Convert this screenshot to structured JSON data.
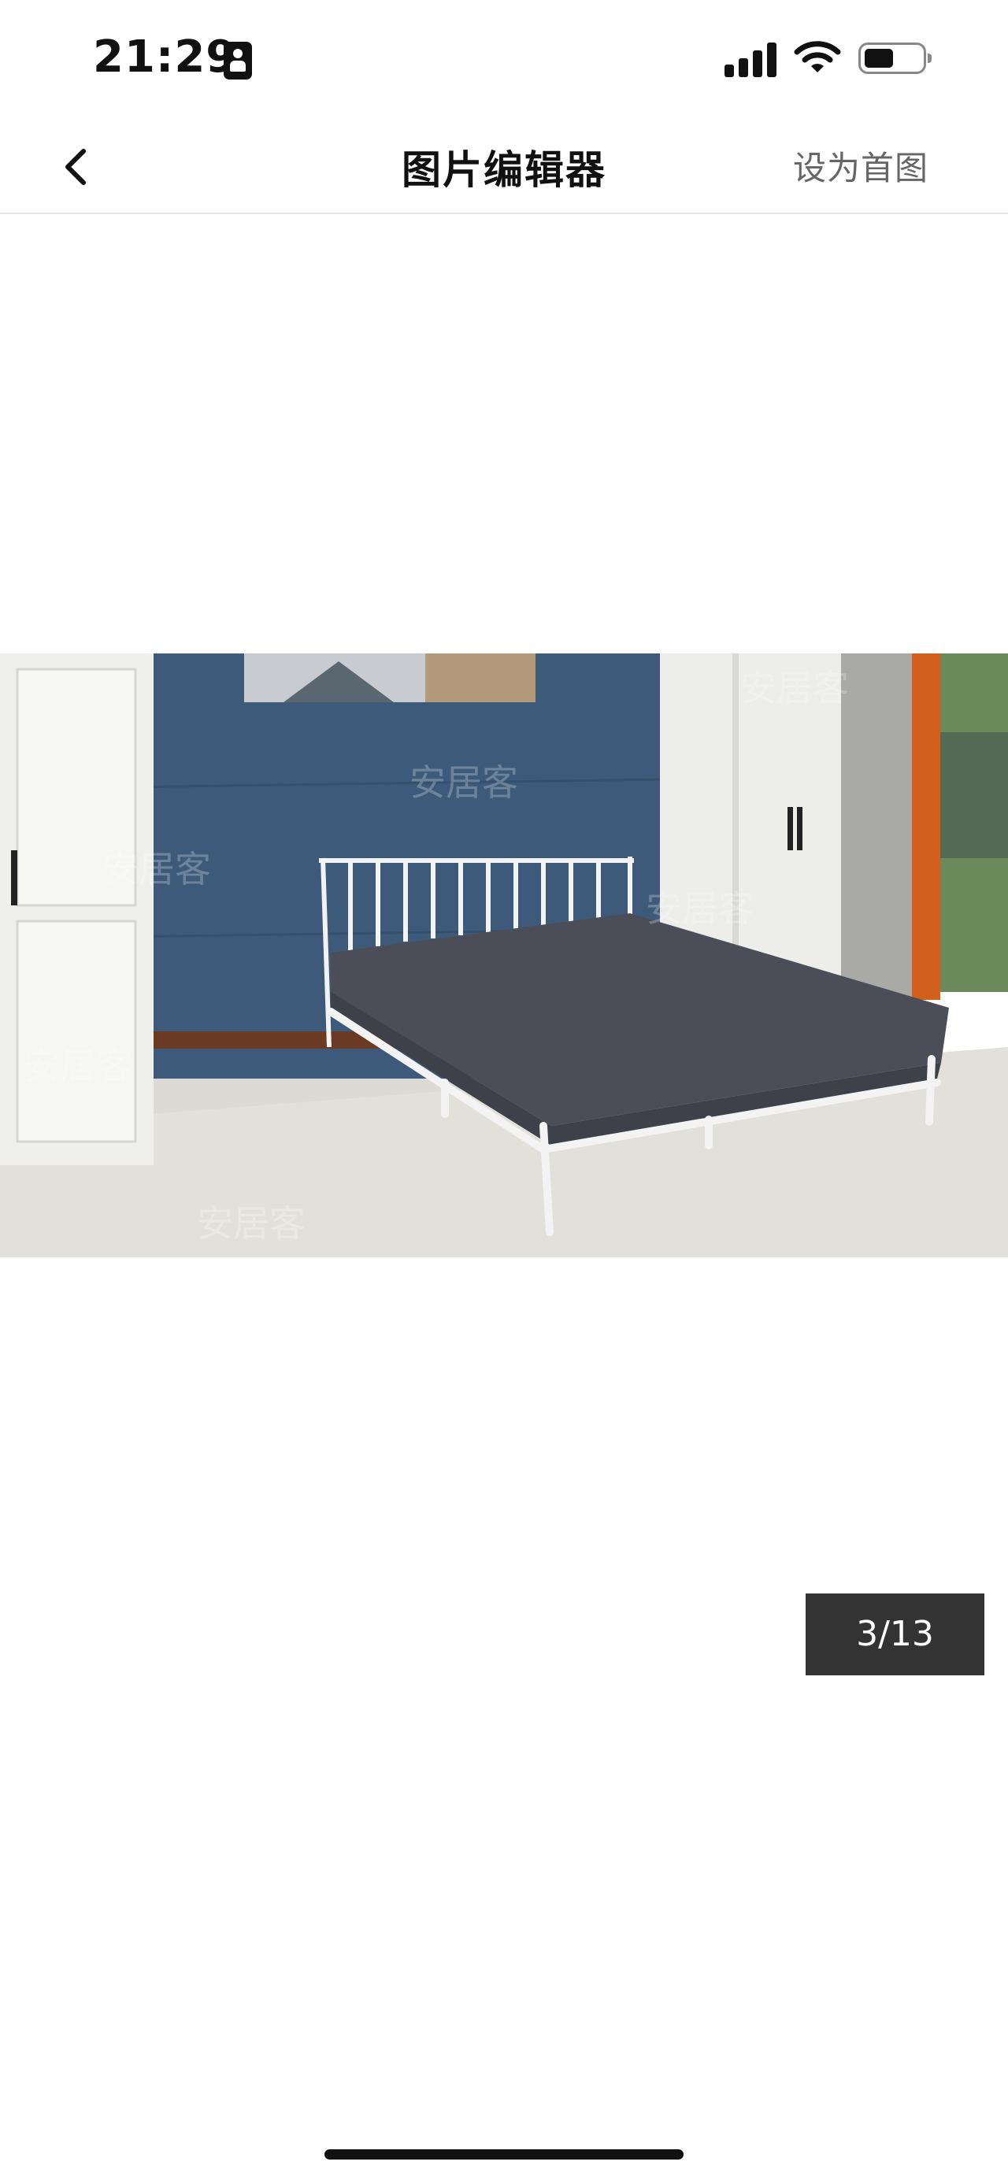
{
  "status_bar": {
    "time": "21:29",
    "icons": [
      "contact-badge-icon",
      "signal-icon",
      "wifi-icon",
      "battery-icon"
    ]
  },
  "nav": {
    "back_icon": "chevron-left-icon",
    "title": "图片编辑器",
    "action_label": "设为首图"
  },
  "photo": {
    "description_icon": "bedroom-photo",
    "watermark": "安居客"
  },
  "pager": {
    "counter": "3/13"
  },
  "colors": {
    "counter_bg": "#333333",
    "action_text": "#666666",
    "wall_blue": "#3d5a7a"
  }
}
